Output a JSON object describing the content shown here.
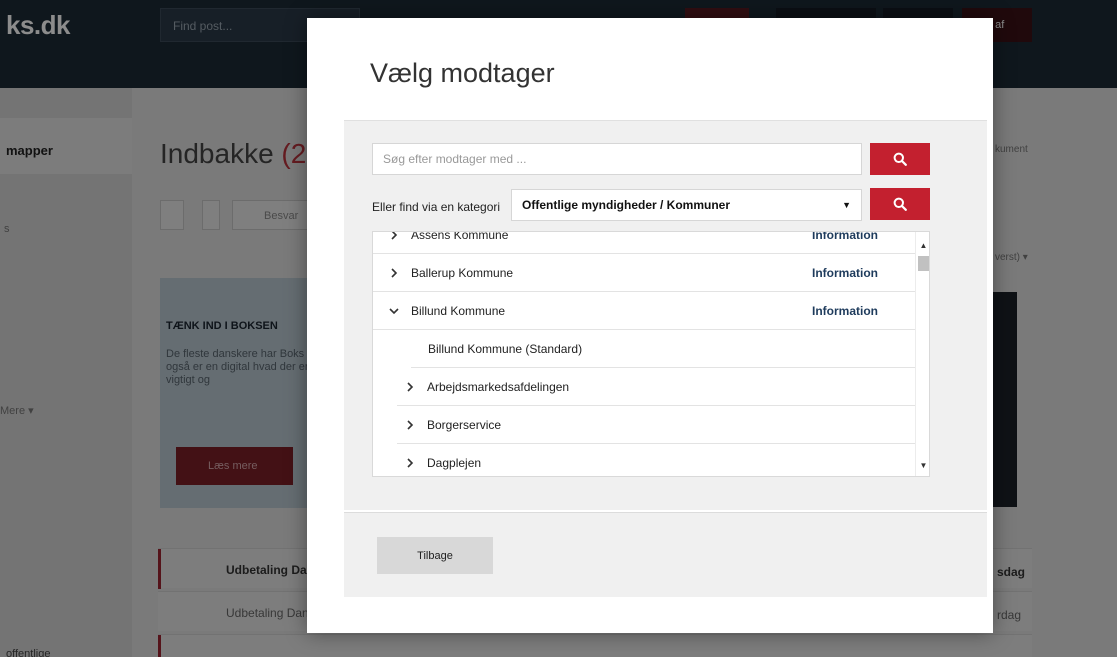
{
  "background": {
    "logo": "ks.dk",
    "header_search_placeholder": "Find post...",
    "header_logout": "g af",
    "sidebar_folders": "mapper",
    "sidebar_small_1": "s",
    "sidebar_more": "Mere ▾",
    "sidebar_bottom": "offentlige",
    "inbox_title": "Indbakke",
    "inbox_count": "(2",
    "reply_label": "Besvar",
    "banner_heading": "TÆNK IND I BOKSEN",
    "banner_text": "De fleste danskere har Boks også er en digital hvad der er vigtigt og",
    "banner_button": "Læs mere",
    "rows": [
      {
        "text": "Udbetaling Da",
        "bold": true,
        "right": "sdag"
      },
      {
        "text": "Udbetaling Dan",
        "bold": false,
        "right": "rdag"
      }
    ],
    "right_doc": "kument",
    "right_sort": "verst) ▾"
  },
  "modal": {
    "title": "Vælg modtager",
    "search_placeholder": "Søg efter modtager med ...",
    "category_label": "Eller find via en kategori",
    "category_value": "Offentlige myndigheder / Kommuner",
    "back_button": "Tilbage",
    "recipients": [
      {
        "label": "Assens Kommune",
        "info": "Information",
        "level": 0,
        "expanded": false
      },
      {
        "label": "Ballerup Kommune",
        "info": "Information",
        "level": 0,
        "expanded": false
      },
      {
        "label": "Billund Kommune",
        "info": "Information",
        "level": 0,
        "expanded": true
      },
      {
        "label": "Billund Kommune (Standard)",
        "info": "",
        "level": 1,
        "leaf": true
      },
      {
        "label": "Arbejdsmarkedsafdelingen",
        "info": "",
        "level": 1,
        "expanded": false
      },
      {
        "label": "Borgerservice",
        "info": "",
        "level": 1,
        "expanded": false
      },
      {
        "label": "Dagplejen",
        "info": "",
        "level": 1,
        "expanded": false
      }
    ]
  },
  "colors": {
    "accent_red": "#c3202f",
    "info_blue": "#1e3b5c"
  }
}
